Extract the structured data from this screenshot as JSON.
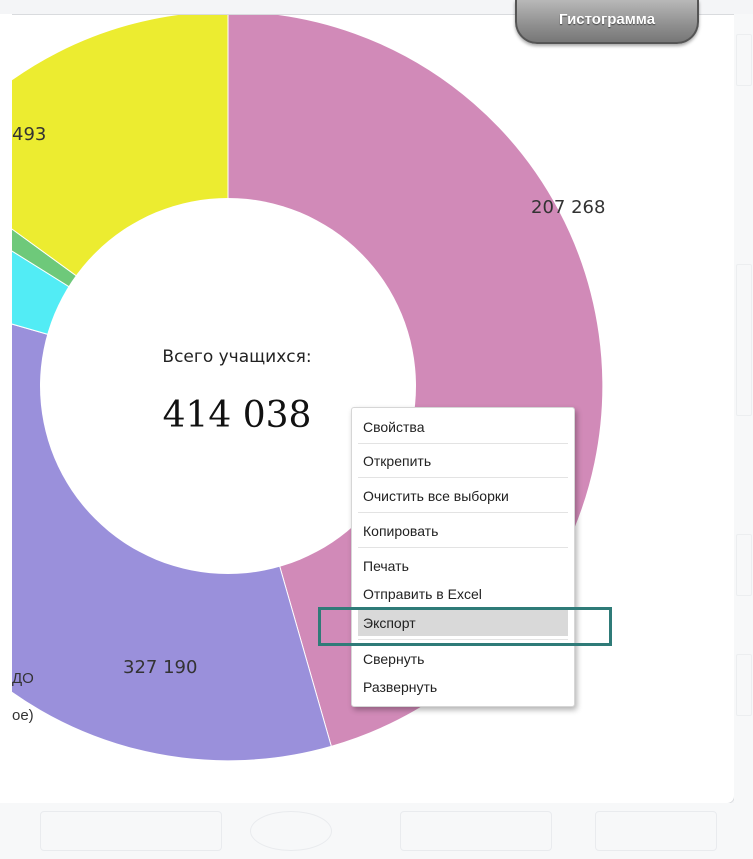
{
  "histogram_button": {
    "label": "Гистограмма"
  },
  "chart_data": {
    "type": "pie",
    "variant": "donut",
    "center_title": "Всего учащихся:",
    "center_value": "414 038",
    "data_labels": [
      "207 268",
      "327 190",
      "493"
    ],
    "legend_fragments": [
      "ДО",
      "oe)"
    ],
    "colors": [
      "#d18ab8",
      "#9a90db",
      "#52ecf5",
      "#6ec97a",
      "#ecec30"
    ]
  },
  "context_menu": {
    "items": [
      {
        "label": "Свойства"
      },
      {
        "label": "Открепить"
      },
      {
        "label": "Очистить все выборки"
      },
      {
        "label": "Копировать"
      },
      {
        "label": "Печать"
      },
      {
        "label": "Отправить в Excel"
      },
      {
        "label": "Экспорт",
        "active": true
      },
      {
        "label": "Свернуть"
      },
      {
        "label": "Развернуть"
      }
    ],
    "highlight_color": "#2f7b78"
  }
}
